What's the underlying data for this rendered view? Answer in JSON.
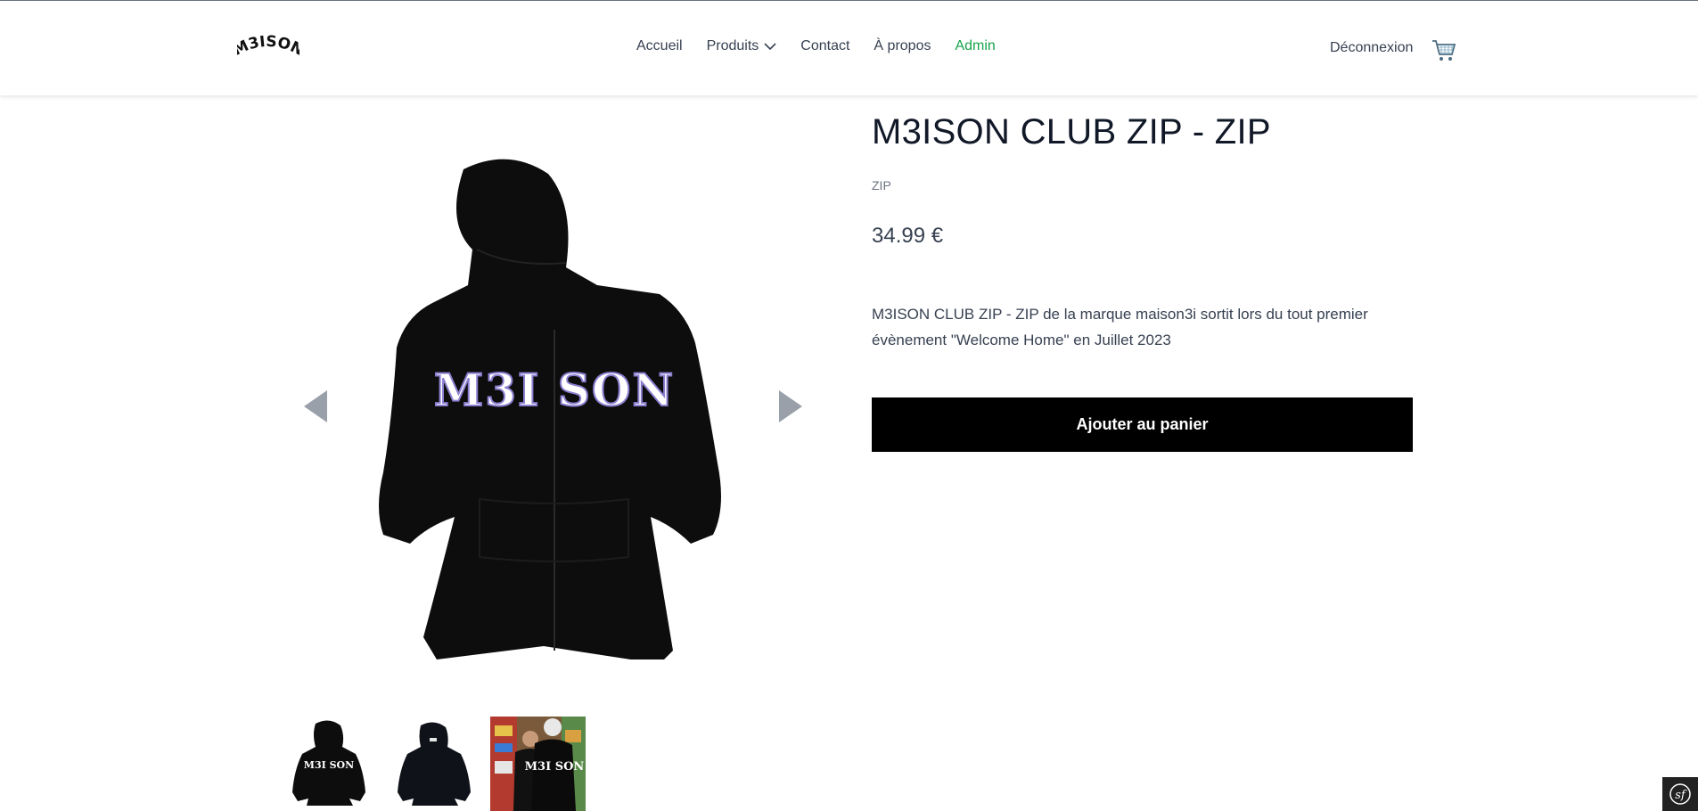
{
  "brand": {
    "logo_text": "M3ISON"
  },
  "nav": {
    "items": [
      {
        "label": "Accueil"
      },
      {
        "label": "Produits",
        "has_dropdown": true
      },
      {
        "label": "Contact"
      },
      {
        "label": "À propos"
      },
      {
        "label": "Admin"
      }
    ],
    "logout_label": "Déconnexion",
    "cart_icon": "cart-icon",
    "admin_color": "#16a34a"
  },
  "product": {
    "title": "M3ISON CLUB ZIP - ZIP",
    "category": "ZIP",
    "price": "34.99 €",
    "description": "M3ISON CLUB ZIP - ZIP de la marque maison3i sortit lors du tout premier évènement \"Welcome Home\" en Juillet 2023",
    "add_to_cart_label": "Ajouter au panier",
    "image_print_text": "M3I SON"
  },
  "gallery": {
    "prev_icon": "arrow-left-icon",
    "next_icon": "arrow-right-icon",
    "thumbnails": [
      {
        "description_icon": "hoodie-front-thumbnail",
        "print_text": "M3I SON"
      },
      {
        "description_icon": "hoodie-back-thumbnail"
      },
      {
        "description_icon": "hoodie-worn-photo-thumbnail",
        "print_text": "M3I SON"
      }
    ]
  },
  "debug_toolbar": {
    "label": "sf"
  }
}
